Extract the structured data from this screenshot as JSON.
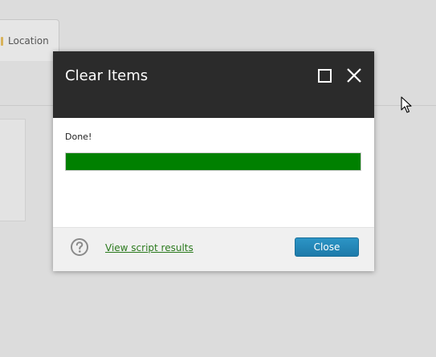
{
  "background": {
    "tab_label": "Location"
  },
  "dialog": {
    "title": "Clear Items",
    "status_text": "Done!",
    "progress": {
      "fraction": 1.0,
      "color": "#008000"
    },
    "footer": {
      "link_label": "View script results",
      "close_label": "Close"
    },
    "icons": {
      "maximize": "maximize-icon",
      "close": "close-icon",
      "help": "help-icon"
    }
  },
  "colors": {
    "header": "#2b2b2b",
    "button": "#2289bb",
    "link": "#2b7a1d"
  }
}
